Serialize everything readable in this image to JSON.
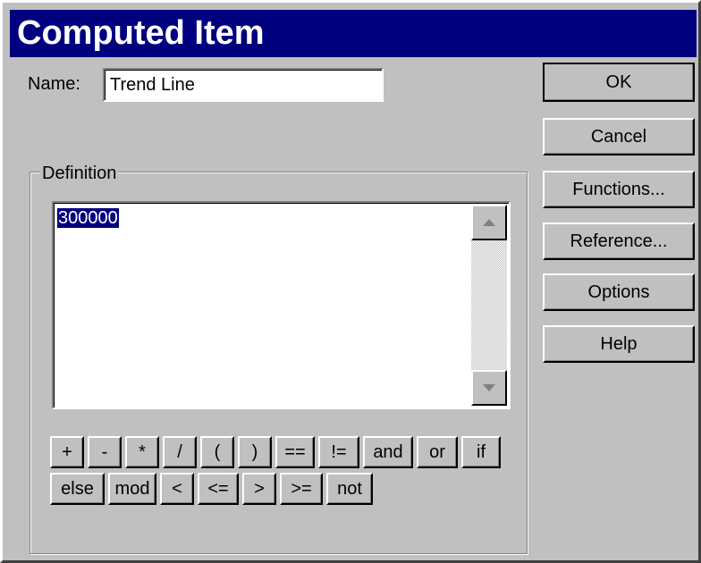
{
  "title": "Computed Item",
  "name_label": "Name:",
  "name_value": "Trend Line",
  "definition": {
    "group_label": "Definition",
    "text": "300000"
  },
  "buttons": {
    "ok": "OK",
    "cancel": "Cancel",
    "functions": "Functions...",
    "reference": "Reference...",
    "options": "Options",
    "help": "Help"
  },
  "operators_row1": [
    "+",
    "-",
    "*",
    "/",
    "(",
    ")",
    "==",
    "!=",
    "and",
    "or",
    "if"
  ],
  "operators_row2": [
    "else",
    "mod",
    "<",
    "<=",
    ">",
    ">=",
    "not"
  ],
  "icons": {
    "scroll_up": "scroll-up-arrow",
    "scroll_down": "scroll-down-arrow"
  },
  "colors": {
    "titlebar": "#00007f",
    "face": "#c0c0c0",
    "selection": "#00007f"
  }
}
